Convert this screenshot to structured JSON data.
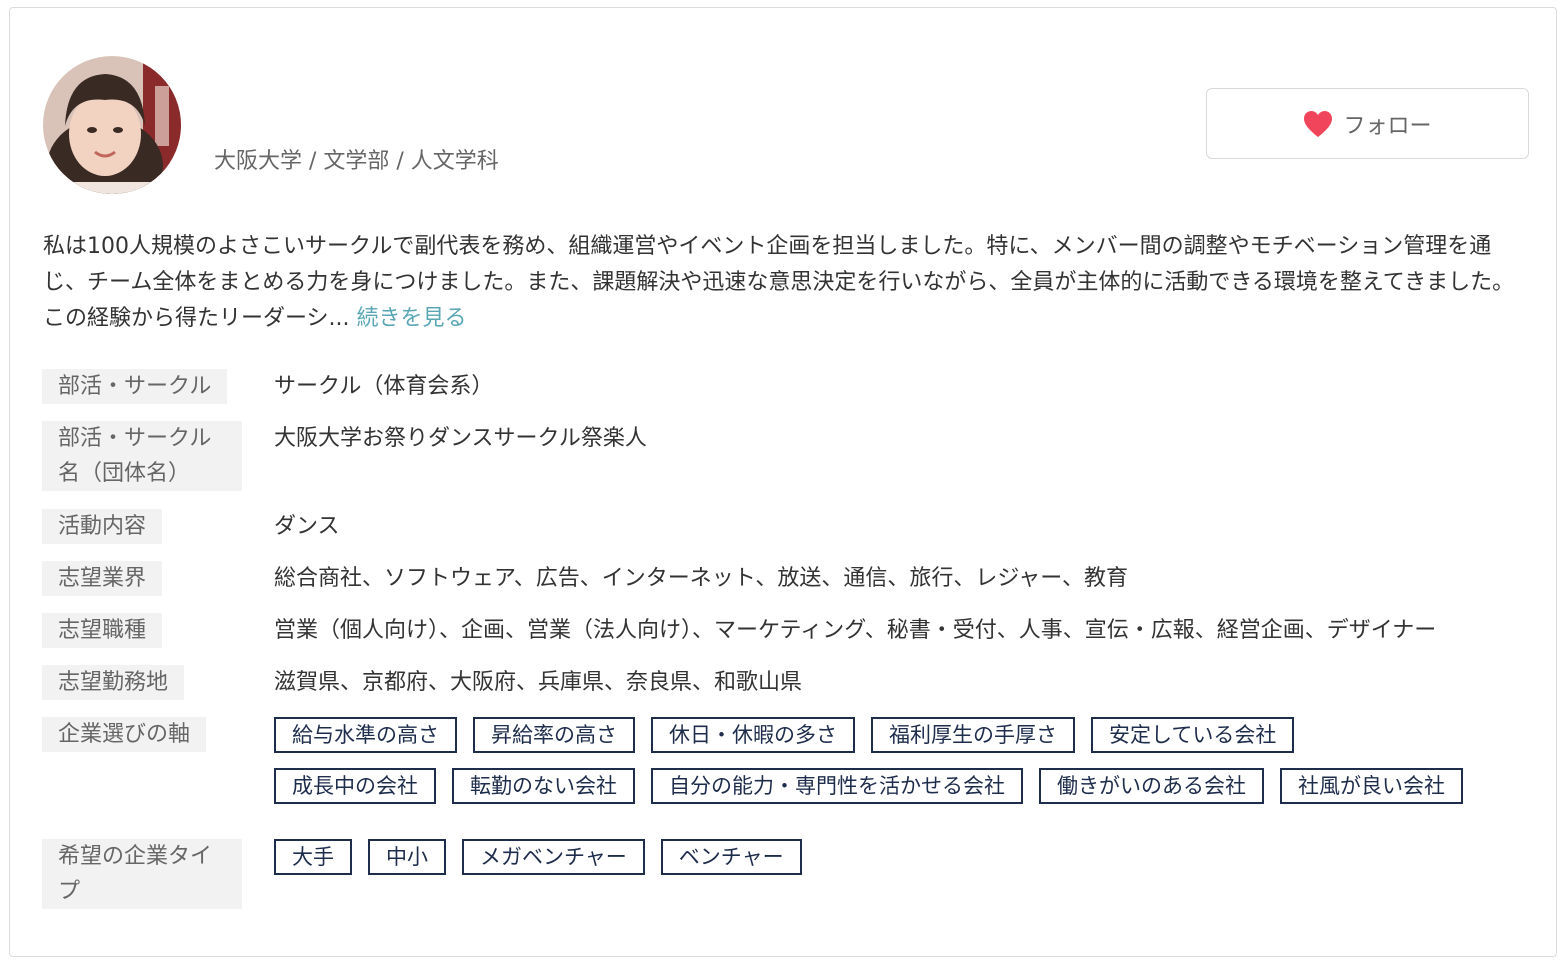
{
  "profile": {
    "affiliation": "大阪大学 / 文学部 / 人文学科",
    "follow_label": "フォロー",
    "bio_text": "私は100人規模のよさこいサークルで副代表を務め、組織運営やイベント企画を担当しました。特に、メンバー間の調整やモチベーション管理を通じ、チーム全体をまとめる力を身につけました。また、課題解決や迅速な意思決定を行いながら、全員が主体的に活動できる環境を整えてきました。この経験から得たリーダーシ...",
    "read_more": "続きを見る"
  },
  "details": {
    "club_label": "部活・サークル",
    "club_value": "サークル（体育会系）",
    "club_name_label": "部活・サークル名（団体名）",
    "club_name_value": "大阪大学お祭りダンスサークル祭楽人",
    "activity_label": "活動内容",
    "activity_value": "ダンス",
    "industry_label": "志望業界",
    "industry_value": "総合商社、ソフトウェア、広告、インターネット、放送、通信、旅行、レジャー、教育",
    "job_label": "志望職種",
    "job_value": "営業（個人向け）、企画、営業（法人向け）、マーケティング、秘書・受付、人事、宣伝・広報、経営企画、デザイナー",
    "location_label": "志望勤務地",
    "location_value": "滋賀県、京都府、大阪府、兵庫県、奈良県、和歌山県",
    "axis_label": "企業選びの軸",
    "axis_tags": [
      "給与水準の高さ",
      "昇給率の高さ",
      "休日・休暇の多さ",
      "福利厚生の手厚さ",
      "安定している会社",
      "成長中の会社",
      "転勤のない会社",
      "自分の能力・専門性を活かせる会社",
      "働きがいのある会社",
      "社風が良い会社"
    ],
    "company_type_label": "希望の企業タイプ",
    "company_type_tags": [
      "大手",
      "中小",
      "メガベンチャー",
      "ベンチャー"
    ]
  },
  "colors": {
    "heart": "#f0455a",
    "link": "#5aa6b5",
    "tag_border": "#1f2d4d",
    "label_bg": "#f2f2f2"
  },
  "icons": {
    "avatar": "profile-photo",
    "follow": "heart-icon"
  }
}
